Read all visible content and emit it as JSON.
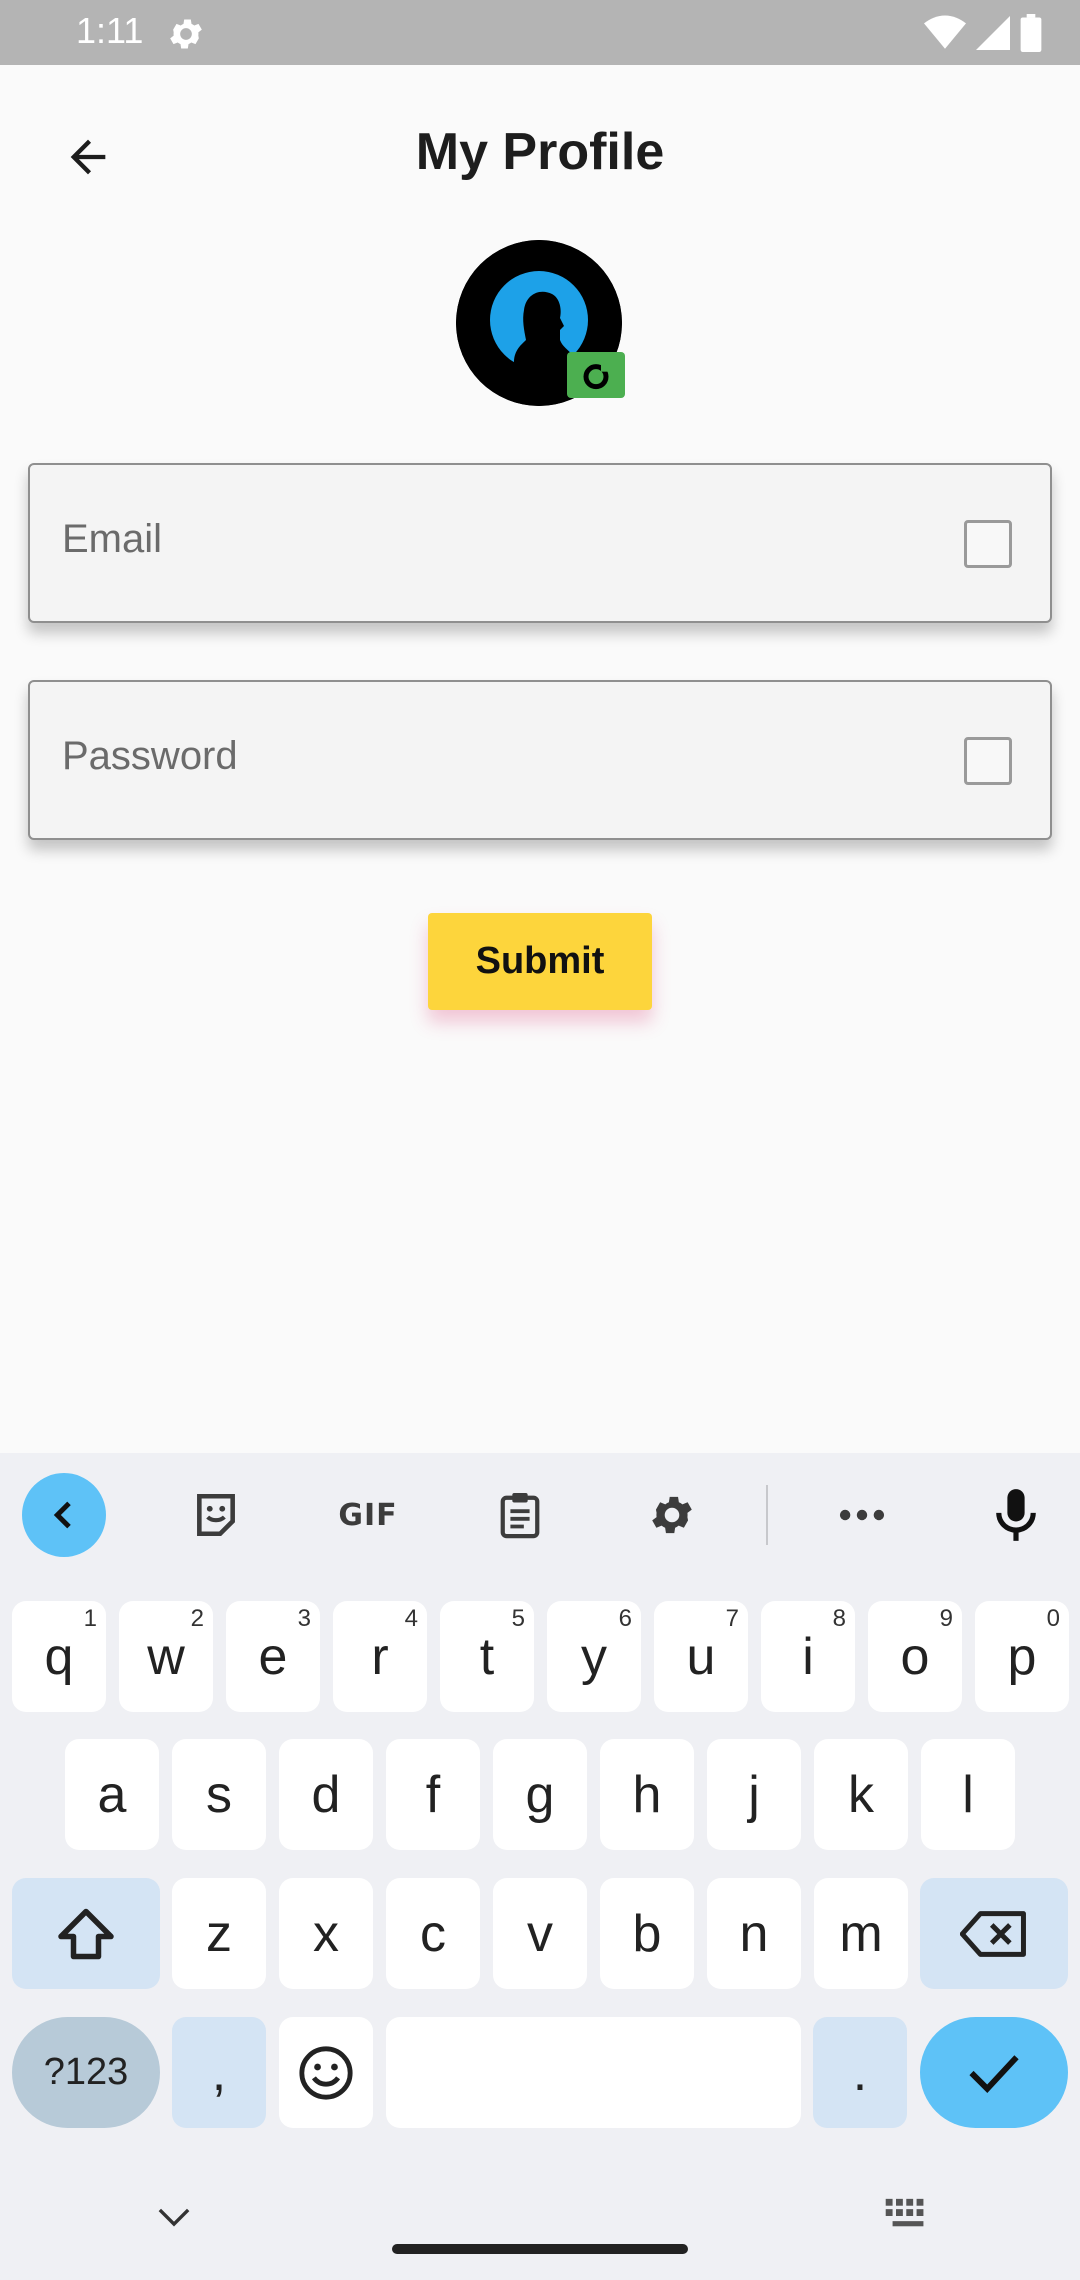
{
  "status_bar": {
    "time": "1:11",
    "icons": [
      "settings-gear-icon",
      "wifi-icon",
      "cell-signal-icon",
      "battery-icon"
    ]
  },
  "app_bar": {
    "title": "My Profile",
    "back_icon": "arrow-left-icon"
  },
  "profile": {
    "avatar_icon": "person-silhouette-icon",
    "camera_icon": "camera-icon",
    "camera_badge_color": "#4caf50"
  },
  "form": {
    "email_placeholder": "Email",
    "password_placeholder": "Password",
    "submit_label": "Submit",
    "submit_color": "#fdd53c"
  },
  "keyboard": {
    "toolbar": [
      "chevron-left-icon",
      "sticker-icon",
      "gif",
      "clipboard-icon",
      "settings-icon",
      "more-icon",
      "mic-icon"
    ],
    "gif_label": "GIF",
    "row1": [
      {
        "key": "q",
        "hint": "1"
      },
      {
        "key": "w",
        "hint": "2"
      },
      {
        "key": "e",
        "hint": "3"
      },
      {
        "key": "r",
        "hint": "4"
      },
      {
        "key": "t",
        "hint": "5"
      },
      {
        "key": "y",
        "hint": "6"
      },
      {
        "key": "u",
        "hint": "7"
      },
      {
        "key": "i",
        "hint": "8"
      },
      {
        "key": "o",
        "hint": "9"
      },
      {
        "key": "p",
        "hint": "0"
      }
    ],
    "row2": [
      "a",
      "s",
      "d",
      "f",
      "g",
      "h",
      "j",
      "k",
      "l"
    ],
    "row3": [
      "z",
      "x",
      "c",
      "v",
      "b",
      "n",
      "m"
    ],
    "symbols_label": "?123",
    "comma": ",",
    "period": ".",
    "accent_color": "#5ec2f7"
  },
  "nav_bar": {
    "icons": [
      "chevron-down-icon",
      "home-pill",
      "keyboard-icon"
    ]
  }
}
